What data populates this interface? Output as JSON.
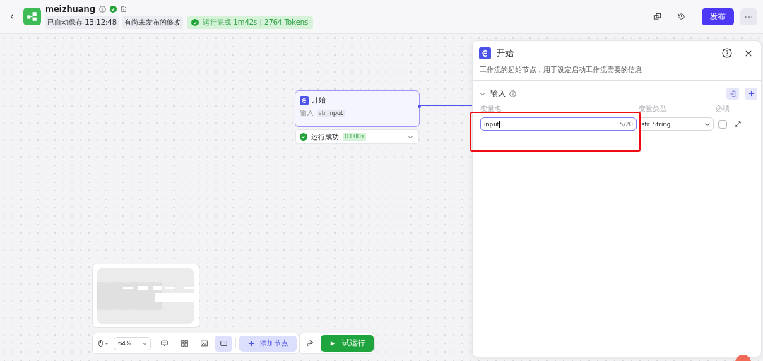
{
  "header": {
    "title": "meizhuang",
    "published": true,
    "autosave": "已自动保存 13:12:48",
    "unpublished": "有尚未发布的修改",
    "run_status": "运行完成 1m42s | 2764 Tokens",
    "publish_button": "发布"
  },
  "node": {
    "title": "开始",
    "selected": true,
    "input_label": "输入",
    "input_type": "str",
    "input_name": "input",
    "run_result": "运行成功",
    "run_time": "0.000s"
  },
  "panel": {
    "title": "开始",
    "description": "工作流的起始节点，用于设定启动工作流需要的信息",
    "section": {
      "title": "输入",
      "expanded": true
    },
    "columns": [
      "变量名",
      "变量类型",
      "必填"
    ],
    "variables": [
      {
        "name": "input",
        "counter": "5/20",
        "type": "str. String",
        "required": false
      }
    ]
  },
  "toolbar": {
    "zoom": "64%",
    "tools": [
      {
        "kind": "comment",
        "selected": false
      },
      {
        "kind": "layout",
        "selected": false
      },
      {
        "kind": "image",
        "selected": false
      },
      {
        "kind": "minimap",
        "selected": true
      }
    ],
    "add_node": "添加节点",
    "test_run": "试运行"
  }
}
